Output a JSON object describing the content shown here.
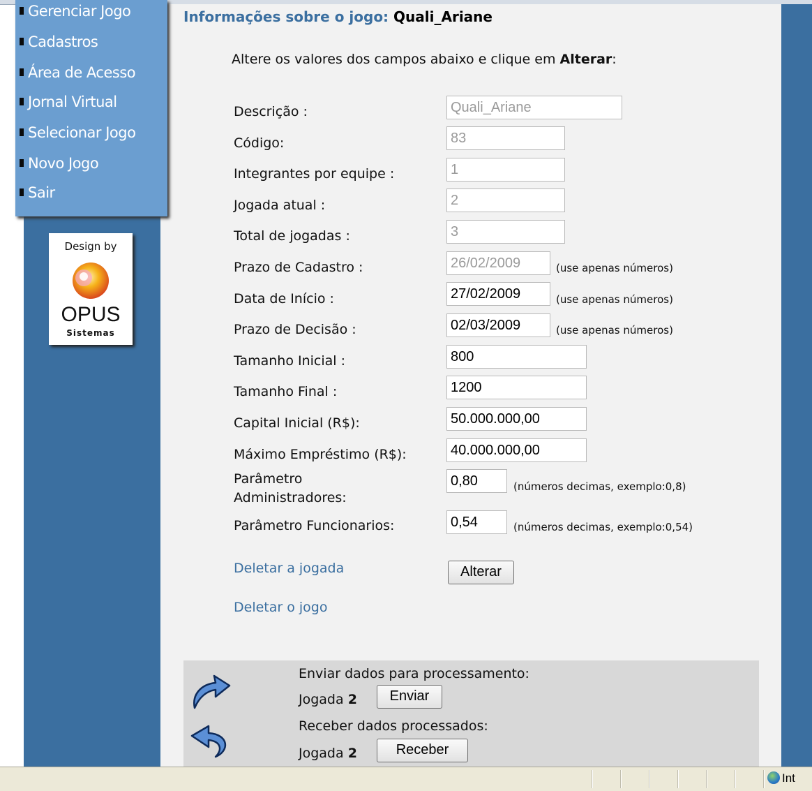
{
  "menu": {
    "items": [
      {
        "label": "Gerenciar Jogo"
      },
      {
        "label": "Cadastros"
      },
      {
        "label": "Área de Acesso"
      },
      {
        "label": "Jornal Virtual"
      },
      {
        "label": "Selecionar Jogo"
      },
      {
        "label": "Novo Jogo"
      },
      {
        "label": "Sair"
      }
    ]
  },
  "logo": {
    "design_by": "Design by",
    "brand": "OPUS",
    "sub": "Sistemas"
  },
  "header": {
    "title_prefix": "Informações sobre o jogo:",
    "game_name": "Quali_Ariane"
  },
  "instruction": {
    "text": "Altere os valores dos campos abaixo e clique em",
    "action": "Alterar",
    "suffix": ":"
  },
  "fields": {
    "descricao": {
      "label": "Descrição :",
      "value": "Quali_Ariane"
    },
    "codigo": {
      "label": "Código:",
      "value": "83"
    },
    "integrantes": {
      "label": "Integrantes por equipe :",
      "value": "1"
    },
    "jogada_atual": {
      "label": "Jogada atual :",
      "value": "2"
    },
    "total_jogadas": {
      "label": "Total de jogadas :",
      "value": "3"
    },
    "prazo_cadastro": {
      "label": "Prazo de Cadastro :",
      "value": "26/02/2009",
      "hint": "(use apenas números)"
    },
    "data_inicio": {
      "label": "Data de Início :",
      "value": "27/02/2009",
      "hint": "(use apenas números)"
    },
    "prazo_decisao": {
      "label": "Prazo de Decisão :",
      "value": "02/03/2009",
      "hint": "(use apenas números)"
    },
    "tamanho_inicial": {
      "label": "Tamanho Inicial :",
      "value": "800"
    },
    "tamanho_final": {
      "label": "Tamanho Final :",
      "value": "1200"
    },
    "capital_inicial": {
      "label": "Capital Inicial (R$):",
      "value": "50.000.000,00"
    },
    "maximo_emprestimo": {
      "label": "Máximo Empréstimo (R$):",
      "value": "40.000.000,00"
    },
    "param_admin": {
      "label_line1": "Parâmetro",
      "label_line2": "Administradores:",
      "value": "0,80",
      "hint": "(números decimas, exemplo:0,8)"
    },
    "param_func": {
      "label": "Parâmetro Funcionarios:",
      "value": "0,54",
      "hint": "(números decimas, exemplo:0,54)"
    }
  },
  "actions": {
    "delete_play": "Deletar a jogada",
    "delete_game": "Deletar o jogo",
    "alterar": "Alterar"
  },
  "processing": {
    "send_label": "Enviar dados para processamento:",
    "send_play_prefix": "Jogada",
    "send_play_number": "2",
    "send_button": "Enviar",
    "receive_label": "Receber dados processados:",
    "receive_play_prefix": "Jogada",
    "receive_play_number": "2",
    "receive_button": "Receber"
  },
  "status_bar": {
    "zone_text": "Int"
  },
  "colors": {
    "sidebar": "#3b6fa0",
    "menu": "#6b9ed0",
    "content_bg": "#f2f2f2",
    "link": "#3b6fa0",
    "proc_box": "#d8d8d8"
  }
}
